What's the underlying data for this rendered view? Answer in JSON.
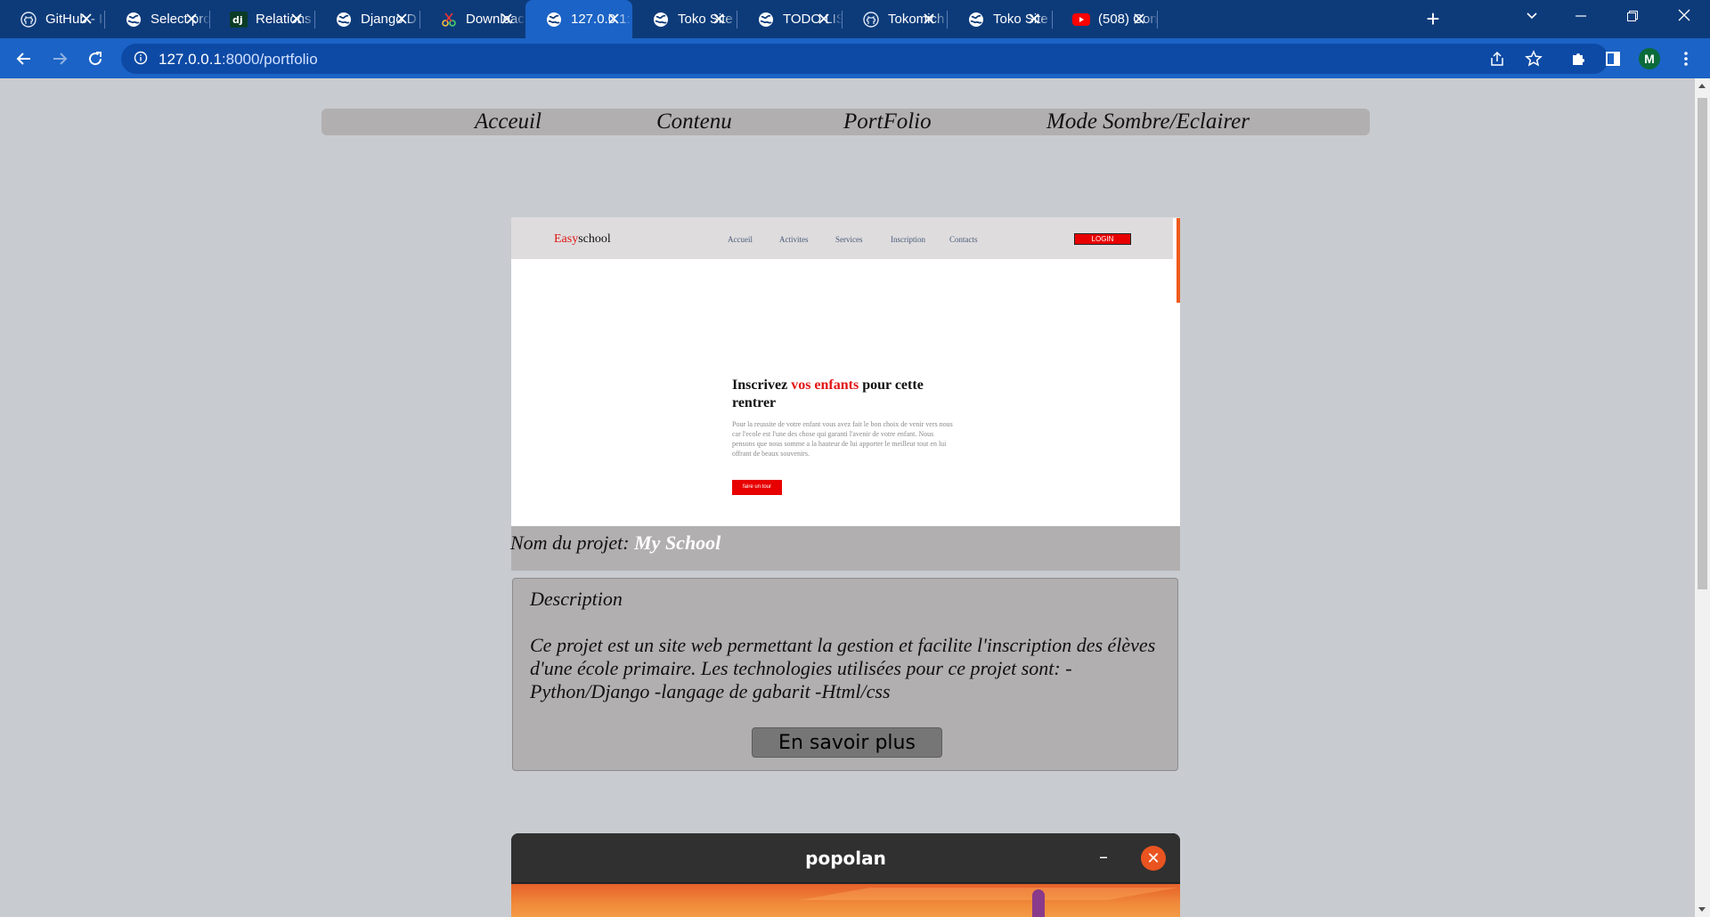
{
  "browser": {
    "tabs": [
      {
        "title": "GitHub - I",
        "icon": "github-icon"
      },
      {
        "title": "Select pro",
        "icon": "globe-icon"
      },
      {
        "title": "Relations",
        "icon": "django-icon"
      },
      {
        "title": "Django D",
        "icon": "globe-icon"
      },
      {
        "title": "Downloac",
        "icon": "scissors-icon"
      },
      {
        "title": "127.0.0.1:",
        "icon": "globe-icon",
        "active": true
      },
      {
        "title": "Toko Site",
        "icon": "globe-icon"
      },
      {
        "title": "TODO LIS",
        "icon": "globe-icon"
      },
      {
        "title": "Tokomich",
        "icon": "github-icon"
      },
      {
        "title": "Toko Site",
        "icon": "globe-icon"
      },
      {
        "title": "(508) Con",
        "icon": "youtube-icon"
      }
    ],
    "url_host": "127.0.0.1",
    "url_path": ":8000/portfolio",
    "profile_initial": "M",
    "accent": "#1b63c6",
    "tabstrip_color": "#0d3b7a"
  },
  "site_nav": {
    "items": [
      "Acceuil",
      "Contenu",
      "PortFolio",
      "Mode Sombre/Eclairer"
    ]
  },
  "project": {
    "screenshot": {
      "logo_red": "Easy",
      "logo_rest": "school",
      "menu": [
        "Accueil",
        "Activites",
        "Services",
        "Inscription",
        "Contacts"
      ],
      "login": "LOGIN",
      "hero_title_1": "Inscrivez ",
      "hero_title_red": "vos enfants",
      "hero_title_2": " pour cette rentrer",
      "hero_text": "Pour la reussite de votre enfant vous avez fait le bon choix de venir vers nous car l'ecole est l'une des chose qui garanti l'avenir de votre enfant. Nous pensons que nous somme a la hauteur de lui apporter le meilleur tout en lui offrant de beaux souvenirs.",
      "hero_button": "faire un tour"
    },
    "name_label": "Nom du projet: ",
    "name_value": "My School",
    "description_title": "Description",
    "description_text": "Ce projet est un site web permettant la gestion et facilite l'inscription des élèves d'une école primaire. Les technologies utilisées pour ce projet sont: -Python/Django -langage de gabarit -Html/css",
    "more_button": "En savoir plus"
  },
  "second_project": {
    "window_title": "popolan",
    "close_color": "#e95420"
  }
}
